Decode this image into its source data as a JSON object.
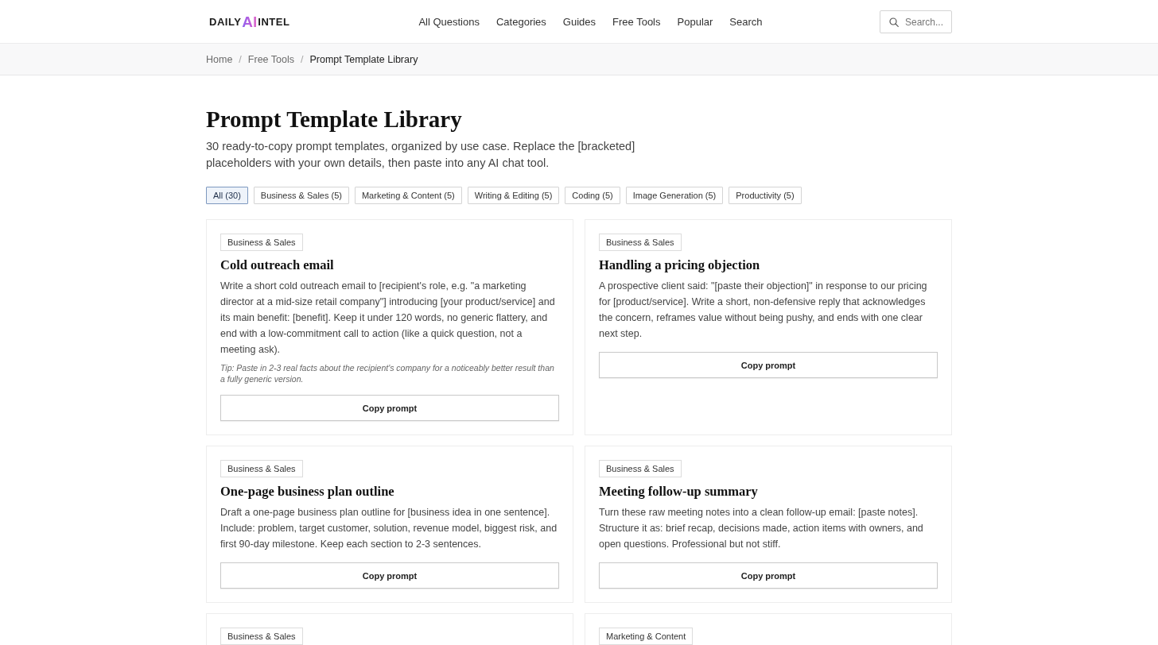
{
  "header": {
    "logo": {
      "prefix": "DAILY",
      "accent": "AI",
      "suffix": "INTEL"
    },
    "nav": [
      "All Questions",
      "Categories",
      "Guides",
      "Free Tools",
      "Popular",
      "Search"
    ],
    "search": {
      "placeholder": "Search..."
    }
  },
  "breadcrumb": [
    {
      "label": "Home",
      "kind": "link"
    },
    {
      "label": "/",
      "kind": "separator"
    },
    {
      "label": "Free Tools",
      "kind": "link"
    },
    {
      "label": "/",
      "kind": "separator"
    },
    {
      "label": "Prompt Template Library",
      "kind": "current"
    }
  ],
  "page": {
    "title": "Prompt Template Library",
    "description": "30 ready-to-copy prompt templates, organized by use case. Replace the [bracketed] placeholders with your own details, then paste into any AI chat tool.",
    "filters": [
      {
        "label": "All (30)",
        "selected": true
      },
      {
        "label": "Business & Sales (5)",
        "selected": false
      },
      {
        "label": "Marketing & Content (5)",
        "selected": false
      },
      {
        "label": "Writing & Editing (5)",
        "selected": false
      },
      {
        "label": "Coding (5)",
        "selected": false
      },
      {
        "label": "Image Generation (5)",
        "selected": false
      },
      {
        "label": "Productivity (5)",
        "selected": false
      }
    ],
    "cards": [
      {
        "tag": "Business & Sales",
        "title": "Cold outreach email",
        "prompt": "Write a short cold outreach email to [recipient's role, e.g. \"a marketing director at a mid-size retail company\"] introducing [your product/service] and its main benefit: [benefit]. Keep it under 120 words, no generic flattery, and end with a low-commitment call to action (like a quick question, not a meeting ask).",
        "tip": "Tip: Paste in 2-3 real facts about the recipient's company for a noticeably better result than a fully generic version.",
        "button": "Copy prompt"
      },
      {
        "tag": "Business & Sales",
        "title": "Handling a pricing objection",
        "prompt": "A prospective client said: \"[paste their objection]\" in response to our pricing for [product/service]. Write a short, non-defensive reply that acknowledges the concern, reframes value without being pushy, and ends with one clear next step.",
        "button": "Copy prompt"
      },
      {
        "tag": "Business & Sales",
        "title": "One-page business plan outline",
        "prompt": "Draft a one-page business plan outline for [business idea in one sentence]. Include: problem, target customer, solution, revenue model, biggest risk, and first 90-day milestone. Keep each section to 2-3 sentences.",
        "button": "Copy prompt"
      },
      {
        "tag": "Business & Sales",
        "title": "Meeting follow-up summary",
        "prompt": "Turn these raw meeting notes into a clean follow-up email: [paste notes]. Structure it as: brief recap, decisions made, action items with owners, and open questions. Professional but not stiff.",
        "button": "Copy prompt"
      },
      {
        "tag": "Business & Sales"
      },
      {
        "tag": "Marketing & Content"
      }
    ]
  }
}
